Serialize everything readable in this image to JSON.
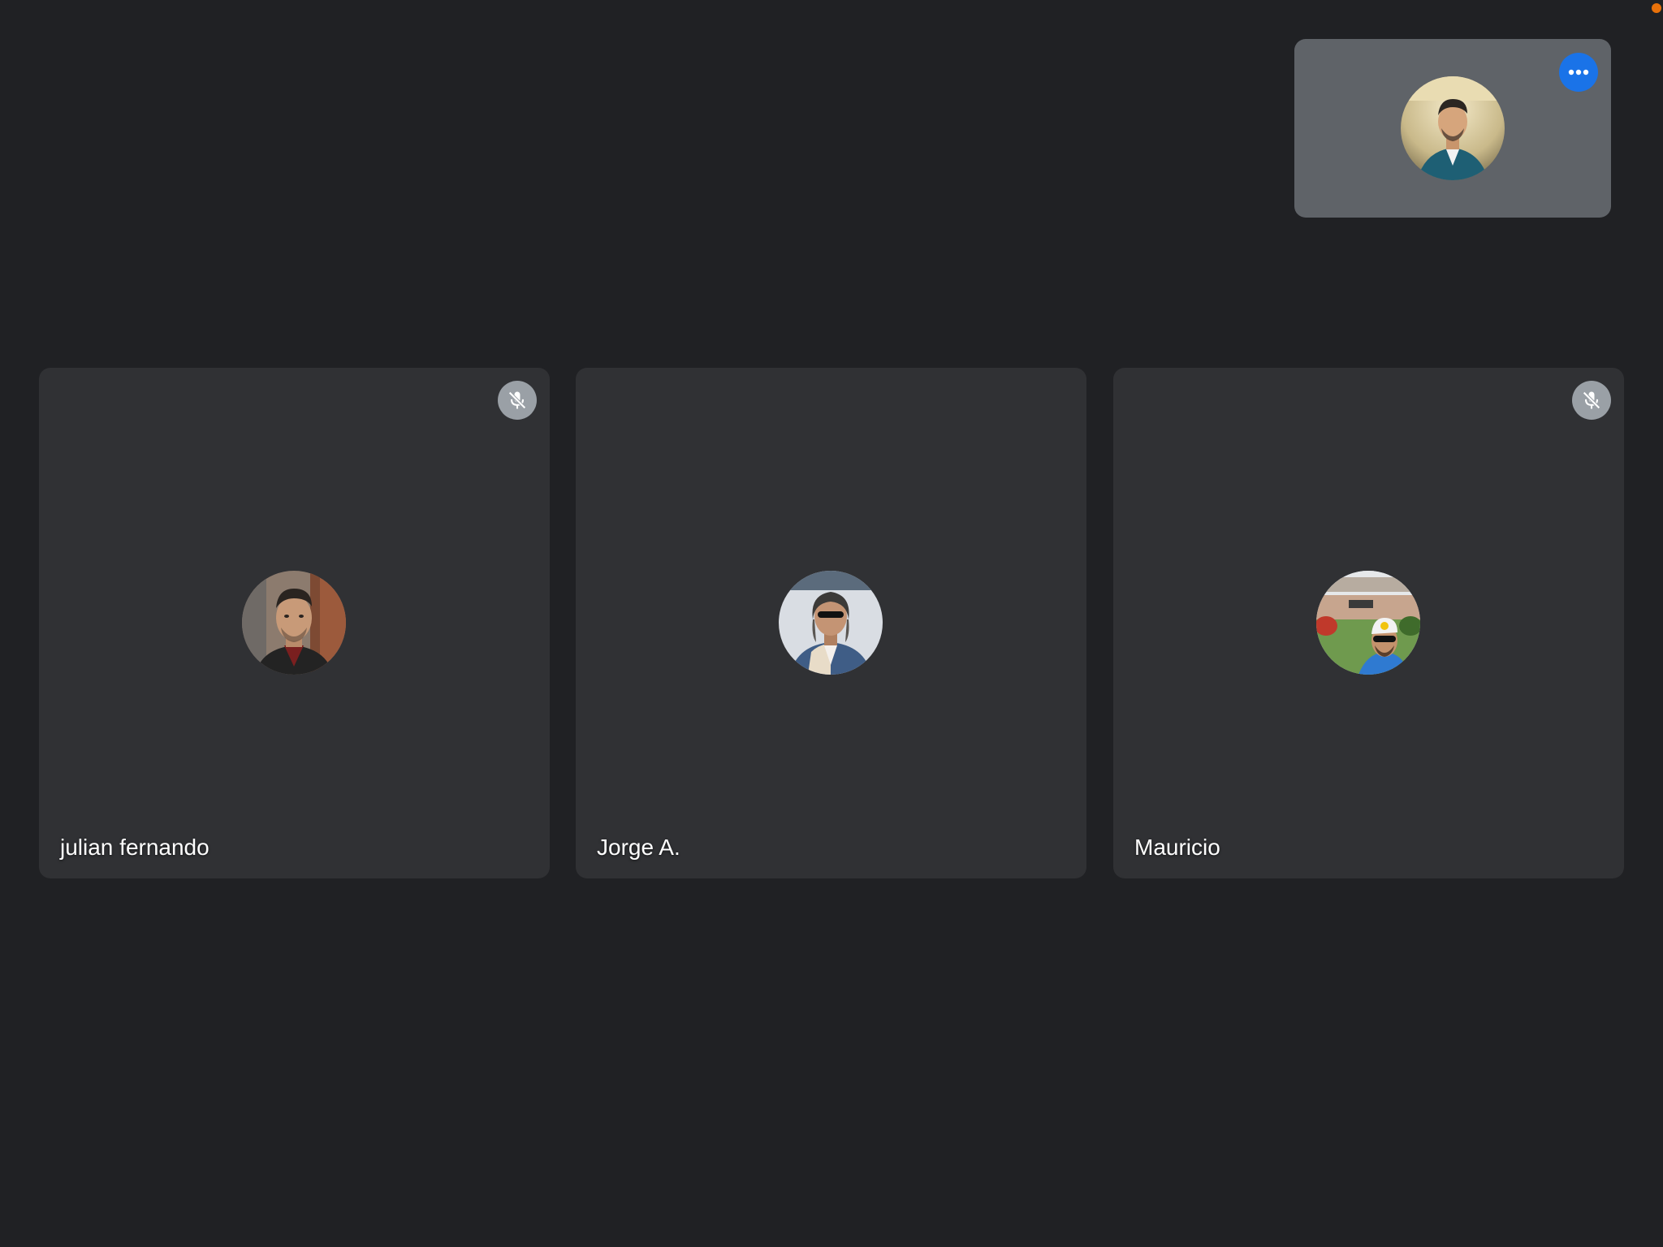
{
  "meeting": {
    "self_view": {
      "avatar_icon": "self-avatar",
      "more_options_icon": "more-horizontal-icon",
      "accent_color": "#1a73e8"
    },
    "participants": [
      {
        "name": "julian fernando",
        "muted": true,
        "avatar_icon": "participant-avatar"
      },
      {
        "name": "Jorge A.",
        "muted": false,
        "avatar_icon": "participant-avatar"
      },
      {
        "name": "Mauricio",
        "muted": true,
        "avatar_icon": "participant-avatar"
      }
    ],
    "colors": {
      "background": "#202124",
      "tile": "#303134",
      "self_tile": "#5f6368",
      "mute_badge": "#9aa0a6",
      "recording": "#e8710a"
    }
  }
}
